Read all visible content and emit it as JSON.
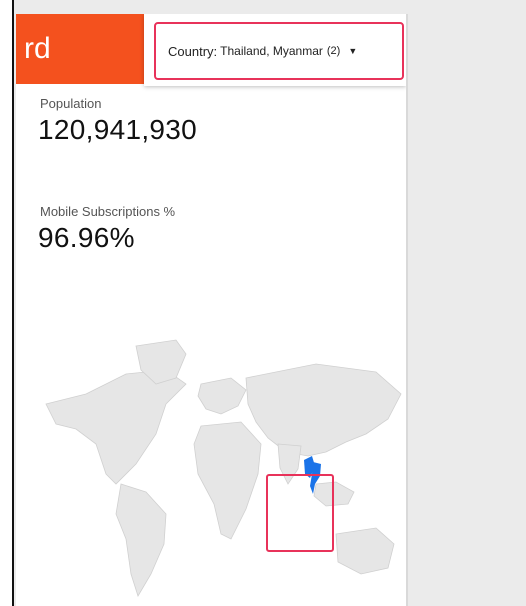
{
  "header": {
    "title_fragment": "rd"
  },
  "filter": {
    "label": "Country",
    "value": "Thailand, Myanmar",
    "count": "(2)"
  },
  "metrics": [
    {
      "label": "Population",
      "value": "120,941,930"
    },
    {
      "label": "Mobile Subscriptions %",
      "value": "96.96%"
    }
  ],
  "colors": {
    "brand": "#f4511e",
    "highlight": "#e8325a",
    "map_selected": "#1a73e8",
    "map_land": "#e6e6e6"
  }
}
